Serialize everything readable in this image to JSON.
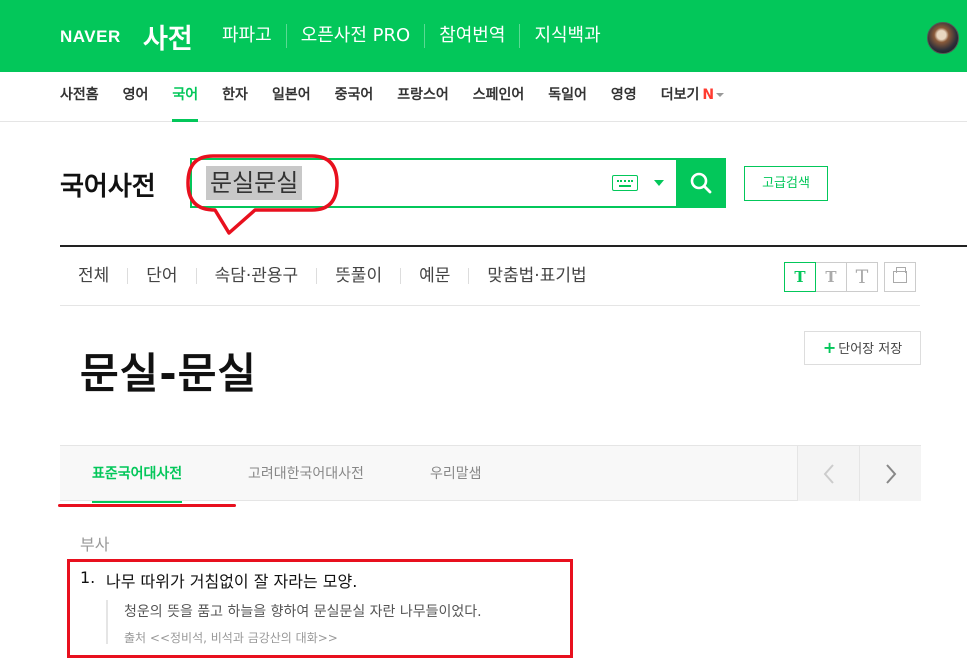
{
  "header": {
    "brand": "NAVER",
    "service": "사전",
    "nav": [
      "파파고",
      "오픈사전 PRO",
      "참여번역",
      "지식백과"
    ]
  },
  "lang_nav": {
    "tabs": [
      "사전홈",
      "영어",
      "국어",
      "한자",
      "일본어",
      "중국어",
      "프랑스어",
      "스페인어",
      "독일어",
      "영영"
    ],
    "active": "국어",
    "more_label": "더보기",
    "more_badge": "N"
  },
  "search": {
    "dict_title": "국어사전",
    "query": "문실문실",
    "advanced_label": "고급검색"
  },
  "categories": [
    "전체",
    "단어",
    "속담·관용구",
    "뜻풀이",
    "예문",
    "맞춤법·표기법"
  ],
  "font_size_buttons": [
    "T",
    "T",
    "T"
  ],
  "entry": {
    "title": "문실-문실",
    "save_label": "단어장 저장",
    "save_plus": "+"
  },
  "sources": {
    "tabs": [
      "표준국어대사전",
      "고려대한국어대사전",
      "우리말샘"
    ],
    "active": "표준국어대사전"
  },
  "definition": {
    "part_of_speech": "부사",
    "number": "1.",
    "text": "나무 따위가 거침없이 잘 자라는 모양.",
    "example": "청운의 뜻을 품고 하늘을 향하여 문실문실 자란 나무들이었다.",
    "source": "출처 <<정비석, 비석과 금강산의 대화>>"
  },
  "colors": {
    "brand_green": "#03c75a",
    "annotation_red": "#e8101e"
  }
}
